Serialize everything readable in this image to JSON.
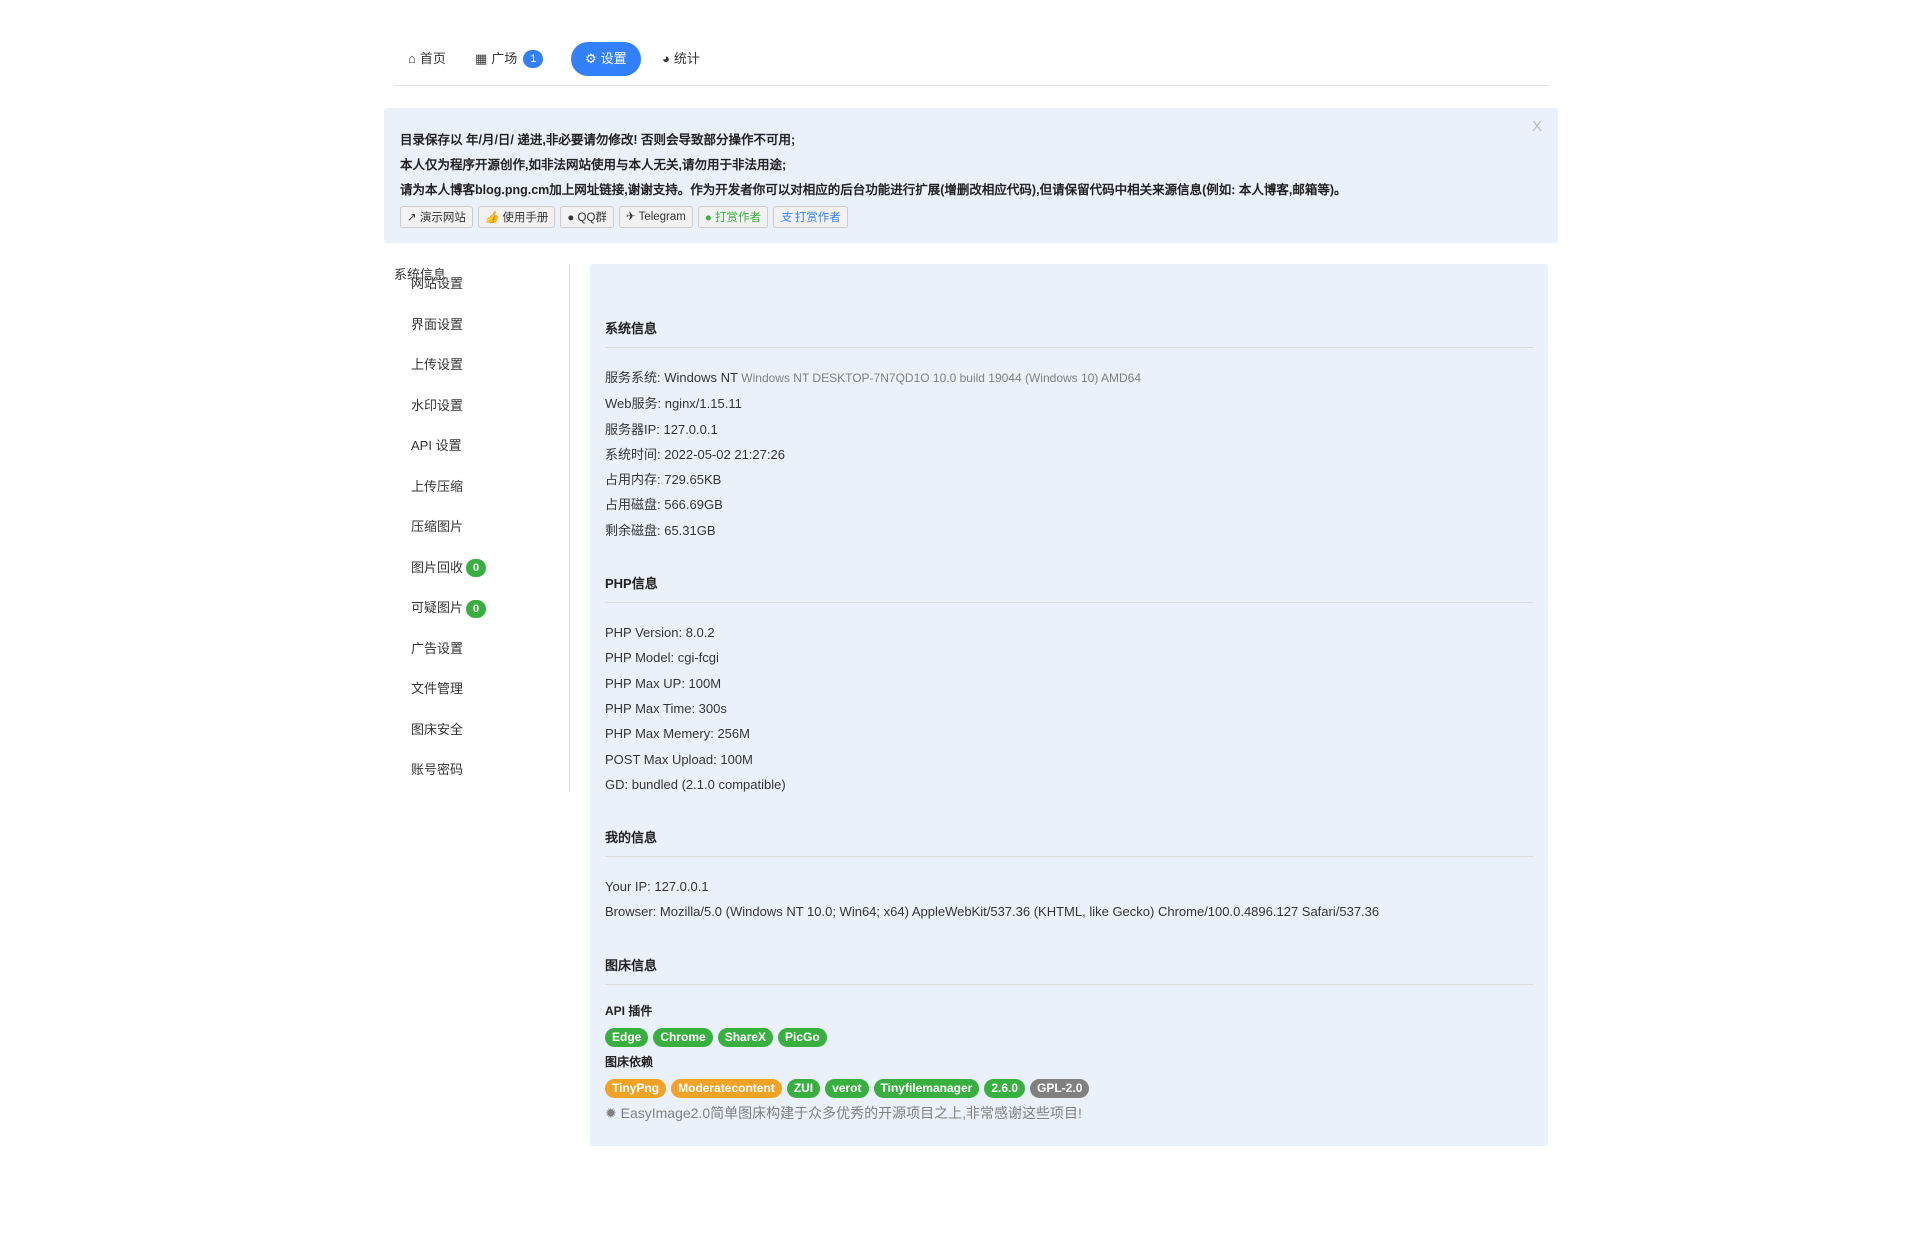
{
  "nav": {
    "home": "首页",
    "square": "广场",
    "square_badge": "1",
    "settings": "设置",
    "stats": "统计"
  },
  "alert": {
    "close": "X",
    "lines": [
      "目录保存以 年/月/日/ 递进,非必要请勿修改! 否则会导致部分操作不可用;",
      "本人仅为程序开源创作,如非法网站使用与本人无关,请勿用于非法用途;",
      "请为本人博客blog.png.cm加上网址链接,谢谢支持。作为开发者你可以对相应的后台功能进行扩展(增删改相应代码),但请保留代码中相关来源信息(例如: 本人博客,邮箱等)。"
    ],
    "buttons": [
      "演示网站",
      "使用手册",
      "QQ群",
      "Telegram",
      "打赏作者",
      "打赏作者"
    ]
  },
  "sidebar": {
    "items": [
      "网站设置",
      "界面设置",
      "上传设置",
      "水印设置",
      "API 设置",
      "上传压缩",
      "压缩图片",
      "图片回收",
      "可疑图片",
      "广告设置",
      "文件管理",
      "图床安全",
      "账号密码",
      "系统信息"
    ],
    "recycle_badge": "0",
    "suspicious_badge": "0"
  },
  "system": {
    "title": "系统信息",
    "os_label": "服务系统: Windows NT",
    "os_detail": "Windows NT DESKTOP-7N7QD1O 10.0 build 19044 (Windows 10) AMD64",
    "lines": [
      "Web服务: nginx/1.15.11",
      "服务器IP: 127.0.0.1",
      "系统时间: 2022-05-02 21:27:26",
      "占用内存: 729.65KB",
      "占用磁盘: 566.69GB",
      "剩余磁盘: 65.31GB"
    ]
  },
  "php": {
    "title": "PHP信息",
    "lines": [
      "PHP Version: 8.0.2",
      "PHP Model: cgi-fcgi",
      "PHP Max UP: 100M",
      "PHP Max Time: 300s",
      "PHP Max Memery: 256M",
      "POST Max Upload: 100M",
      "GD: bundled (2.1.0 compatible)"
    ]
  },
  "mine": {
    "title": "我的信息",
    "lines": [
      "Your IP: 127.0.0.1",
      "Browser: Mozilla/5.0 (Windows NT 10.0; Win64; x64) AppleWebKit/537.36 (KHTML, like Gecko) Chrome/100.0.4896.127 Safari/537.36"
    ]
  },
  "imgbed": {
    "title": "图床信息",
    "api_label": "API 插件",
    "api_tags": [
      "Edge",
      "Chrome",
      "ShareX",
      "PicGo"
    ],
    "dep_label": "图床依赖",
    "dep_tags": [
      "TinyPng",
      "Moderatecontent",
      "ZUI",
      "verot",
      "Tinyfilemanager",
      "2.6.0",
      "GPL-2.0"
    ],
    "footer": "EasyImage2.0简单图床构建于众多优秀的开源项目之上,非常感谢这些项目!"
  },
  "colors": {
    "primary": "#3280fc",
    "success": "#38b03f",
    "warning": "#f1a325",
    "panel": "#eaf1fa"
  }
}
